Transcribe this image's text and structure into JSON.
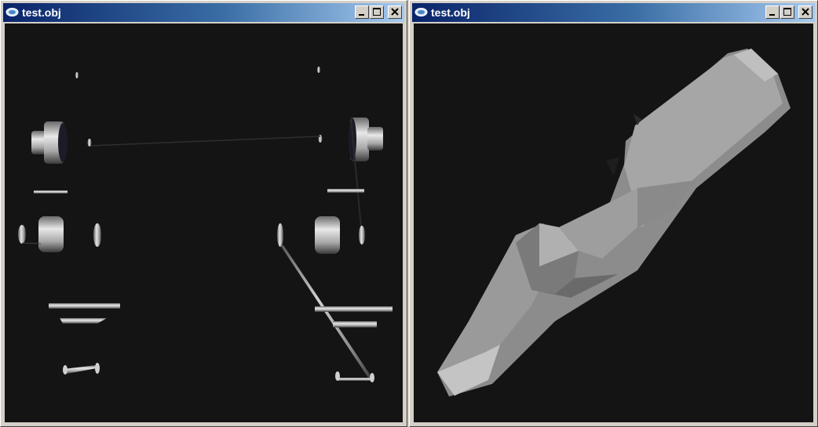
{
  "windows": [
    {
      "title": "test.obj",
      "icon": "app-icon",
      "controls": [
        "minimize-icon",
        "maximize-icon",
        "close-icon"
      ],
      "scene": "multiple-parts"
    },
    {
      "title": "test.obj",
      "icon": "app-icon",
      "controls": [
        "minimize-icon",
        "maximize-icon",
        "close-icon"
      ],
      "scene": "single-part"
    }
  ],
  "colors": {
    "titlebar_start": "#0a246a",
    "titlebar_end": "#a6caf0",
    "viewport_background": "#141414",
    "window_face": "#d4d0c8"
  }
}
